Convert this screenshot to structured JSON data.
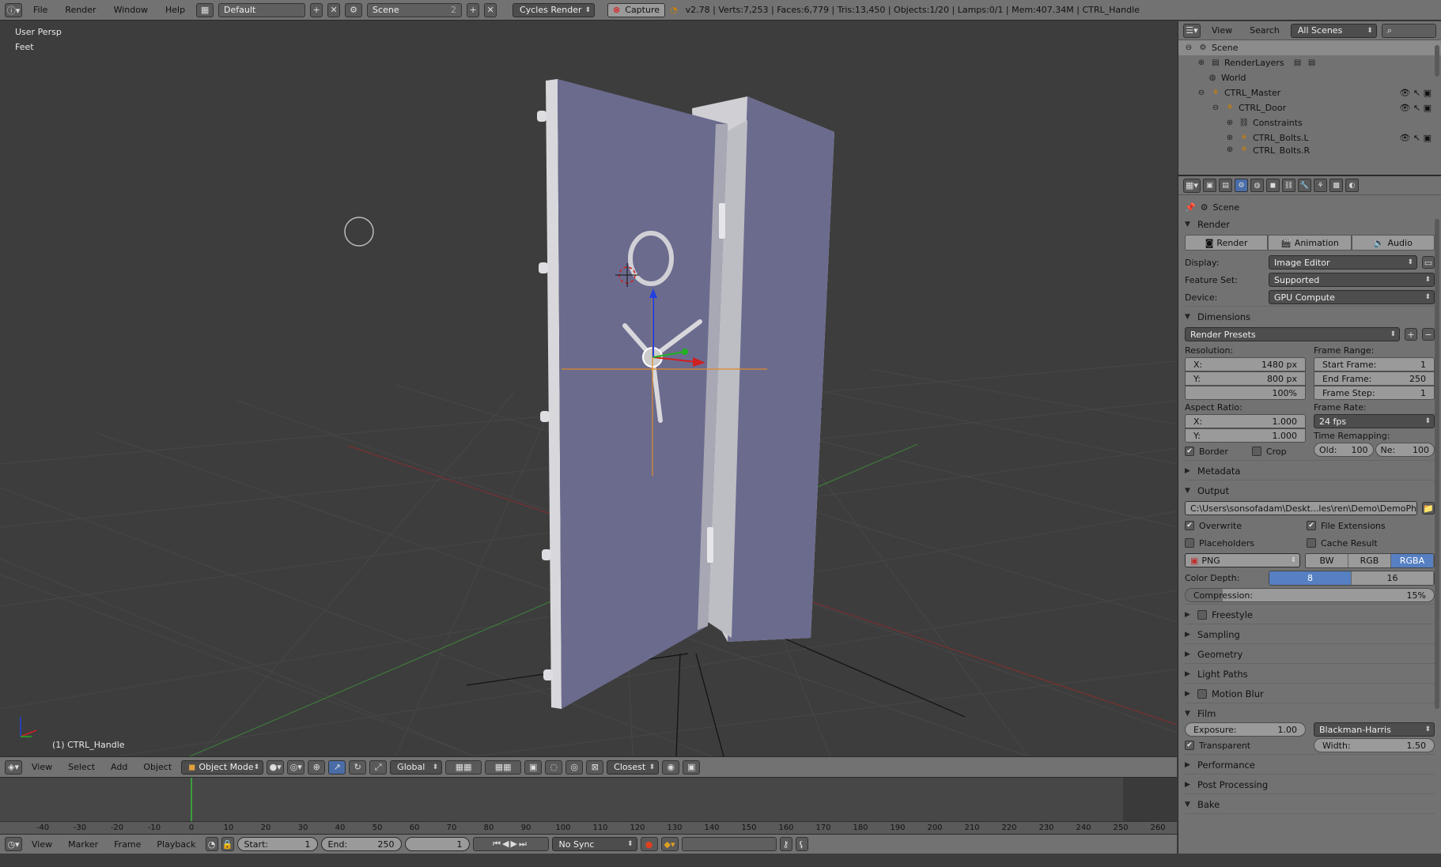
{
  "topbar": {
    "menus": [
      "File",
      "Render",
      "Window",
      "Help"
    ],
    "layout": "Default",
    "scene": "Scene",
    "scene_users": "2",
    "engine": "Cycles Render",
    "capture": "Capture",
    "stats": "v2.78 | Verts:7,253 | Faces:6,779 | Tris:13,450 | Objects:1/20 | Lamps:0/1 | Mem:407.34M | CTRL_Handle"
  },
  "viewport": {
    "view_name": "User Persp",
    "units": "Feet",
    "active_object": "(1) CTRL_Handle"
  },
  "header3d": {
    "menus": [
      "View",
      "Select",
      "Add",
      "Object"
    ],
    "mode": "Object Mode",
    "orientation": "Global",
    "snap": "Closest"
  },
  "timeline": {
    "labels": [
      "-40",
      "-30",
      "-20",
      "-10",
      "0",
      "10",
      "20",
      "30",
      "40",
      "50",
      "60",
      "70",
      "80",
      "90",
      "100",
      "110",
      "120",
      "130",
      "140",
      "150",
      "160",
      "170",
      "180",
      "190",
      "200",
      "210",
      "220",
      "230",
      "240",
      "250",
      "260"
    ],
    "current_frame_value": 0
  },
  "tlbar": {
    "menus": [
      "View",
      "Marker",
      "Frame",
      "Playback"
    ],
    "start_label": "Start:",
    "start": "1",
    "end_label": "End:",
    "end": "250",
    "current": "1",
    "sync": "No Sync"
  },
  "outliner": {
    "menus": [
      "View",
      "Search"
    ],
    "filter": "All Scenes",
    "rows": [
      {
        "label": "Scene",
        "indent": 0,
        "hl": true
      },
      {
        "label": "RenderLayers",
        "indent": 1
      },
      {
        "label": "World",
        "indent": 1
      },
      {
        "label": "CTRL_Master",
        "indent": 1
      },
      {
        "label": "CTRL_Door",
        "indent": 2
      },
      {
        "label": "Constraints",
        "indent": 3
      },
      {
        "label": "CTRL_Bolts.L",
        "indent": 3
      },
      {
        "label": "CTRL_Bolts.R",
        "indent": 3
      }
    ]
  },
  "props": {
    "context": "Scene",
    "render": {
      "title": "Render",
      "buttons": [
        "Render",
        "Animation",
        "Audio"
      ],
      "display_label": "Display:",
      "display": "Image Editor",
      "feature_label": "Feature Set:",
      "feature": "Supported",
      "device_label": "Device:",
      "device": "GPU Compute"
    },
    "dimensions": {
      "title": "Dimensions",
      "presets": "Render Presets",
      "resolution_label": "Resolution:",
      "res_x_label": "X:",
      "res_x": "1480 px",
      "res_y_label": "Y:",
      "res_y": "800 px",
      "res_pct": "100%",
      "frame_range_label": "Frame Range:",
      "start_label": "Start Frame:",
      "start": "1",
      "end_label": "End Frame:",
      "end": "250",
      "step_label": "Frame Step:",
      "step": "1",
      "aspect_label": "Aspect Ratio:",
      "asp_x_label": "X:",
      "asp_x": "1.000",
      "asp_y_label": "Y:",
      "asp_y": "1.000",
      "frame_rate_label": "Frame Rate:",
      "frame_rate": "24 fps",
      "time_remap_label": "Time Remapping:",
      "old_label": "Old:",
      "old": "100",
      "new_label": "Ne:",
      "new": "100",
      "border": "Border",
      "crop": "Crop"
    },
    "metadata": "Metadata",
    "output": {
      "title": "Output",
      "path": "C:\\Users\\sonsofadam\\Deskt...les\\ren\\Demo\\DemoPhoto1-",
      "overwrite": "Overwrite",
      "file_extensions": "File Extensions",
      "placeholders": "Placeholders",
      "cache_result": "Cache Result",
      "format": "PNG",
      "color_modes": [
        "BW",
        "RGB",
        "RGBA"
      ],
      "color_mode_active": "RGBA",
      "depth_label": "Color Depth:",
      "depths": [
        "8",
        "16"
      ],
      "depth_active": "8",
      "compression_label": "Compression:",
      "compression": "15%",
      "compression_value": 0.15
    },
    "collapsed": [
      "Freestyle",
      "Sampling",
      "Geometry",
      "Light Paths",
      "Motion Blur"
    ],
    "film": {
      "title": "Film",
      "exposure_label": "Exposure:",
      "exposure": "1.00",
      "filter": "Blackman-Harris",
      "transparent": "Transparent",
      "width_label": "Width:",
      "width": "1.50"
    },
    "tail": [
      "Performance",
      "Post Processing",
      "Bake"
    ]
  },
  "colors": {
    "accent": "#5680c2",
    "door_face": "#6b6b8e",
    "door_edge": "#cfcfd4"
  }
}
